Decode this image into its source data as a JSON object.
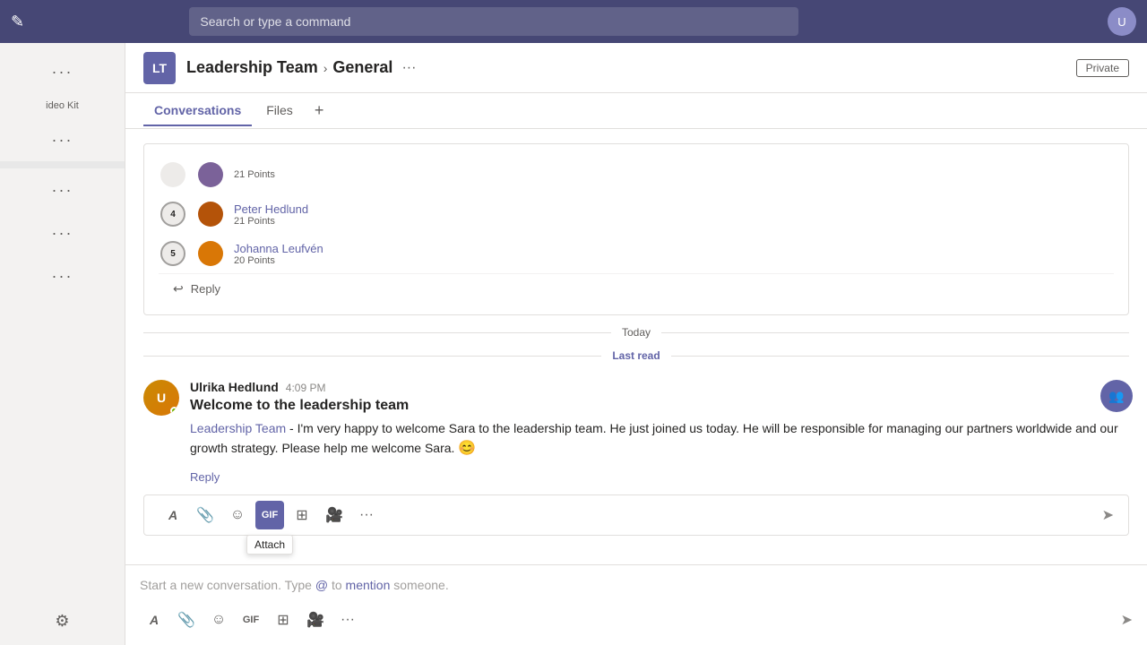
{
  "topbar": {
    "search_placeholder": "Search or type a command"
  },
  "sidebar": {
    "dots_items": [
      "...",
      "...",
      "...",
      "...",
      "..."
    ],
    "bottom_label": "gear"
  },
  "channel": {
    "team_name": "Leadership Team",
    "channel_name": "General",
    "more_dots": "···",
    "private_label": "Private"
  },
  "tabs": [
    {
      "label": "Conversations",
      "active": true
    },
    {
      "label": "Files",
      "active": false
    }
  ],
  "leaderboard": {
    "rows": [
      {
        "rank": "4",
        "user": "Peter Hedlund",
        "points": "21 Points"
      },
      {
        "rank": "5",
        "user": "Johanna Leufvén",
        "points": "20 Points"
      }
    ]
  },
  "reply_label": "Reply",
  "dividers": {
    "today": "Today",
    "last_read": "Last read"
  },
  "message": {
    "sender": "Ulrika Hedlund",
    "time": "4:09 PM",
    "title": "Welcome to the leadership team",
    "mention": "Leadership Team",
    "body": " - I'm very happy to welcome Sara to the leadership team. He just joined us today. He will be responsible for managing our partners worldwide and our growth strategy. Please help me welcome Sara.",
    "emoji": "😊",
    "reply_label": "Reply"
  },
  "toolbar_upper": {
    "buttons": [
      {
        "name": "format",
        "icon": "A",
        "label": "Format"
      },
      {
        "name": "attach",
        "icon": "📎",
        "label": "Attach"
      },
      {
        "name": "emoji",
        "icon": "☺",
        "label": "Emoji"
      },
      {
        "name": "gif",
        "icon": "GIF",
        "label": "GIF",
        "active": true
      },
      {
        "name": "sticker",
        "icon": "⊞",
        "label": "Sticker"
      },
      {
        "name": "video",
        "icon": "📹",
        "label": "Video"
      },
      {
        "name": "more",
        "icon": "···",
        "label": "More"
      }
    ],
    "tooltip": "Attach",
    "send": "➤"
  },
  "compose": {
    "placeholder": "Start a new conversation. Type @ to mention someone.",
    "mention_text": "@",
    "mention_word": "mention"
  },
  "toolbar_lower": {
    "buttons": [
      {
        "name": "format",
        "icon": "A"
      },
      {
        "name": "attach",
        "icon": "📎"
      },
      {
        "name": "emoji",
        "icon": "☺"
      },
      {
        "name": "gif",
        "icon": "GIF"
      },
      {
        "name": "sticker",
        "icon": "⊞"
      },
      {
        "name": "video",
        "icon": "📹"
      },
      {
        "name": "more",
        "icon": "···"
      }
    ],
    "send": "➤"
  }
}
